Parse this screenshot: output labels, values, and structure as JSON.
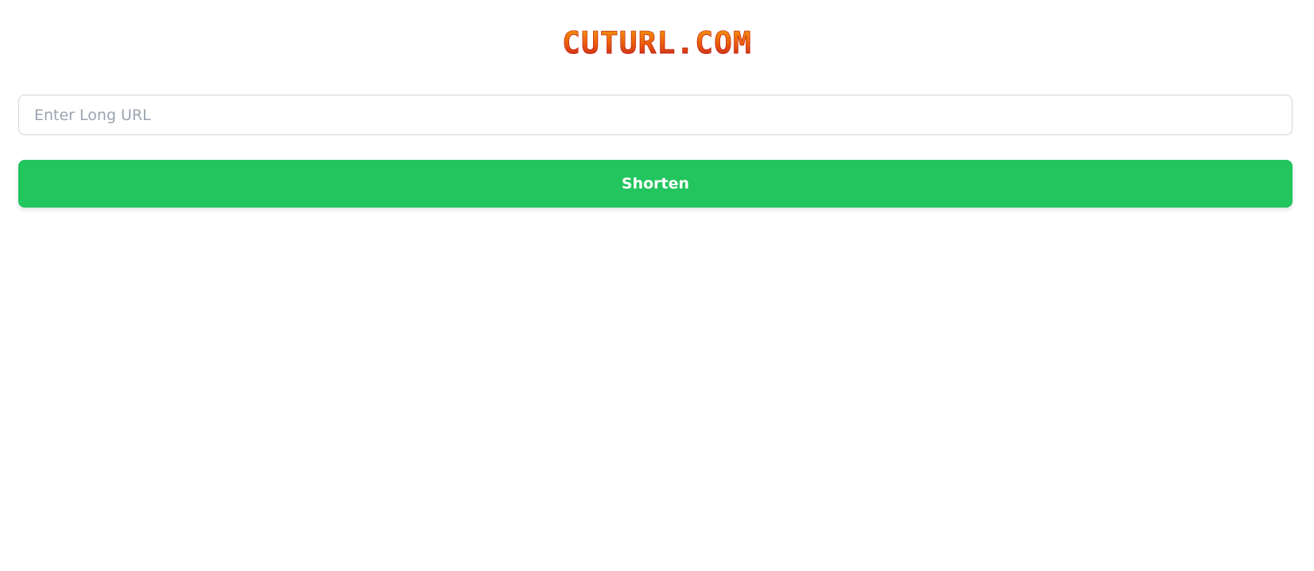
{
  "header": {
    "logo_text": "CUTURL.COM"
  },
  "form": {
    "url_input": {
      "value": "",
      "placeholder": "Enter Long URL"
    },
    "submit_label": "Shorten"
  },
  "colors": {
    "button_background": "#22c55e",
    "button_text": "#ffffff",
    "logo_gradient_top": "#f59e0b",
    "logo_gradient_bottom": "#b91c1c",
    "input_border": "#d1d5db",
    "placeholder_text": "#9ca3af"
  }
}
